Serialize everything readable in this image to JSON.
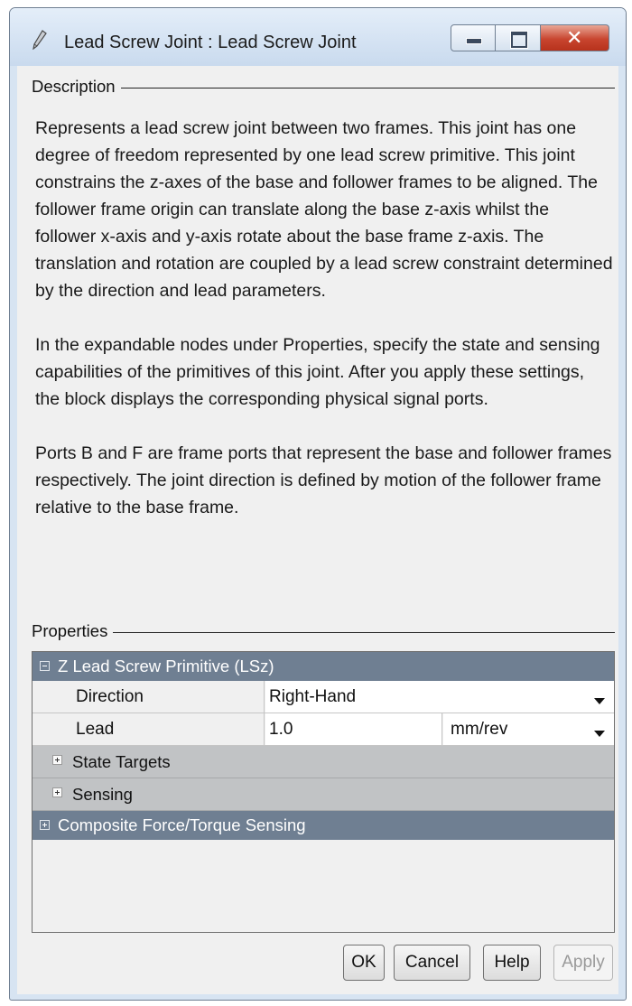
{
  "window": {
    "title": "Lead Screw Joint : Lead Screw Joint",
    "icon": "pencil-icon",
    "controls": {
      "minimize": "minimize-icon",
      "maximize": "maximize-icon",
      "close": "close-icon"
    }
  },
  "description": {
    "group_label": "Description",
    "paragraphs": [
      "Represents a lead screw joint between two frames. This joint has one degree of freedom represented by one lead screw primitive. This joint constrains the z-axes of the base and follower frames to be aligned. The follower frame origin can translate along the base z-axis whilst the follower x-axis and y-axis rotate about the base frame z-axis. The translation and rotation are coupled by a lead screw constraint determined by the direction and lead parameters.",
      "In the expandable nodes under Properties, specify the state and sensing capabilities of the primitives of this joint. After you apply these settings, the block displays the corresponding physical signal ports.",
      "Ports B and F are frame ports that represent the base and follower frames respectively. The joint direction is defined by motion of the follower frame relative to the base frame."
    ]
  },
  "properties": {
    "group_label": "Properties",
    "primitive_section": "Z Lead Screw Primitive (LSz)",
    "direction": {
      "label": "Direction",
      "value": "Right-Hand"
    },
    "lead": {
      "label": "Lead",
      "value": "1.0",
      "unit": "mm/rev"
    },
    "state_targets": "State Targets",
    "sensing": "Sensing",
    "composite_section": "Composite Force/Torque Sensing"
  },
  "buttons": {
    "ok": "OK",
    "cancel": "Cancel",
    "help": "Help",
    "apply": "Apply"
  },
  "colors": {
    "section_header": "#6f7f92",
    "subsection": "#c1c3c5",
    "dialog_background": "#f0f0f0",
    "close_button": "#c8452f"
  }
}
